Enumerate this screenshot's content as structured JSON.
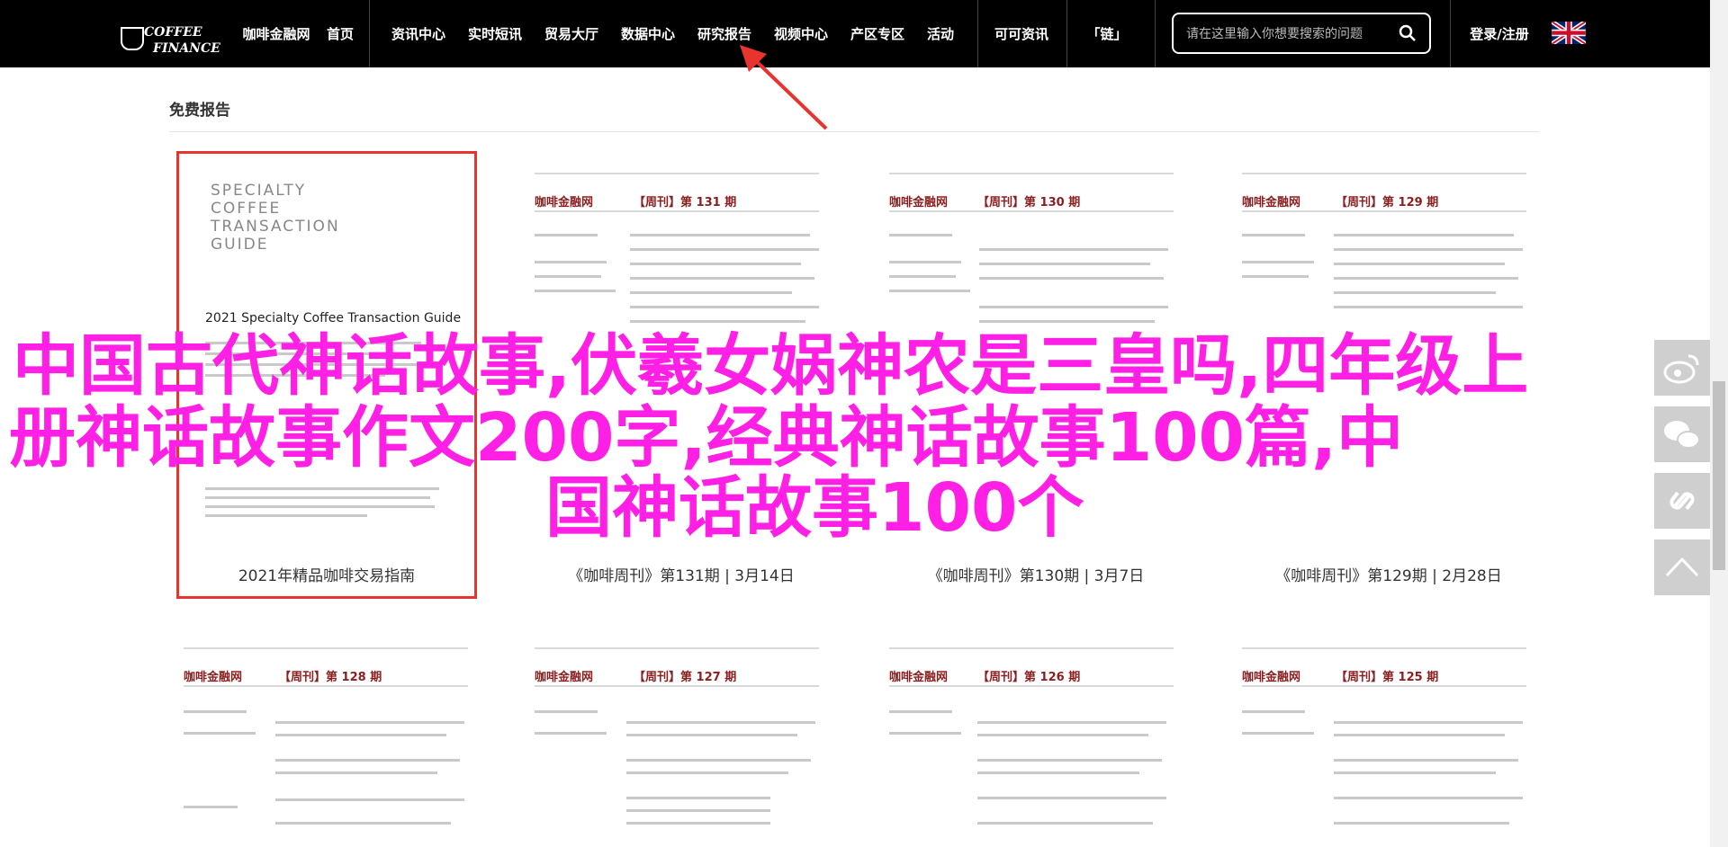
{
  "nav": {
    "logo_line1": "COFFEE",
    "logo_line2": "FINANCE",
    "site_name": "咖啡金融网",
    "items": [
      {
        "label": "首页"
      },
      {
        "label": "资讯中心"
      },
      {
        "label": "实时短讯"
      },
      {
        "label": "贸易大厅"
      },
      {
        "label": "数据中心"
      },
      {
        "label": "研究报告"
      },
      {
        "label": "视频中心"
      },
      {
        "label": "产区专区"
      },
      {
        "label": "活动"
      },
      {
        "label": "可可资讯"
      },
      {
        "label": "「链」"
      }
    ],
    "search_placeholder": "请在这里输入你想要搜索的问题",
    "login": "登录/注册",
    "flag_icon": "uk-flag-icon"
  },
  "section": {
    "title": "免费报告"
  },
  "reports_row1": [
    {
      "caption": "2021年精品咖啡交易指南",
      "cover_title": [
        "SPECIALTY",
        "COFFEE",
        "TRANSACTION",
        "GUIDE"
      ],
      "cover_subtitle": "2021 Specialty Coffee Transaction Guide"
    },
    {
      "caption": "《咖啡周刊》第131期 | 3月14日",
      "brand": "咖啡金融网",
      "issue": "【周刊】第 131 期"
    },
    {
      "caption": "《咖啡周刊》第130期 | 3月7日",
      "brand": "咖啡金融网",
      "issue": "【周刊】第 130 期"
    },
    {
      "caption": "《咖啡周刊》第129期 | 2月28日",
      "brand": "咖啡金融网",
      "issue": "【周刊】第 129 期"
    }
  ],
  "reports_row2": [
    {
      "brand": "咖啡金融网",
      "issue": "【周刊】第 128 期"
    },
    {
      "brand": "咖啡金融网",
      "issue": "【周刊】第 127 期"
    },
    {
      "brand": "咖啡金融网",
      "issue": "【周刊】第 126 期"
    },
    {
      "brand": "咖啡金融网",
      "issue": "【周刊】第 125 期"
    }
  ],
  "overlay": {
    "line1": "中国古代神话故事,伏羲女娲神农是三皇吗,四年级上",
    "line2": "册神话故事作文200字,经典神话故事100篇,中",
    "line3": "国神话故事100个"
  },
  "share": {
    "weibo_icon": "weibo-icon",
    "wechat_icon": "wechat-icon",
    "link_icon": "link-icon",
    "top_icon": "back-to-top-icon"
  },
  "colors": {
    "overlay": "#ff1fe5",
    "highlight": "#e8332f",
    "brand_red": "#8b1e1e",
    "nav_bg": "#000000"
  }
}
